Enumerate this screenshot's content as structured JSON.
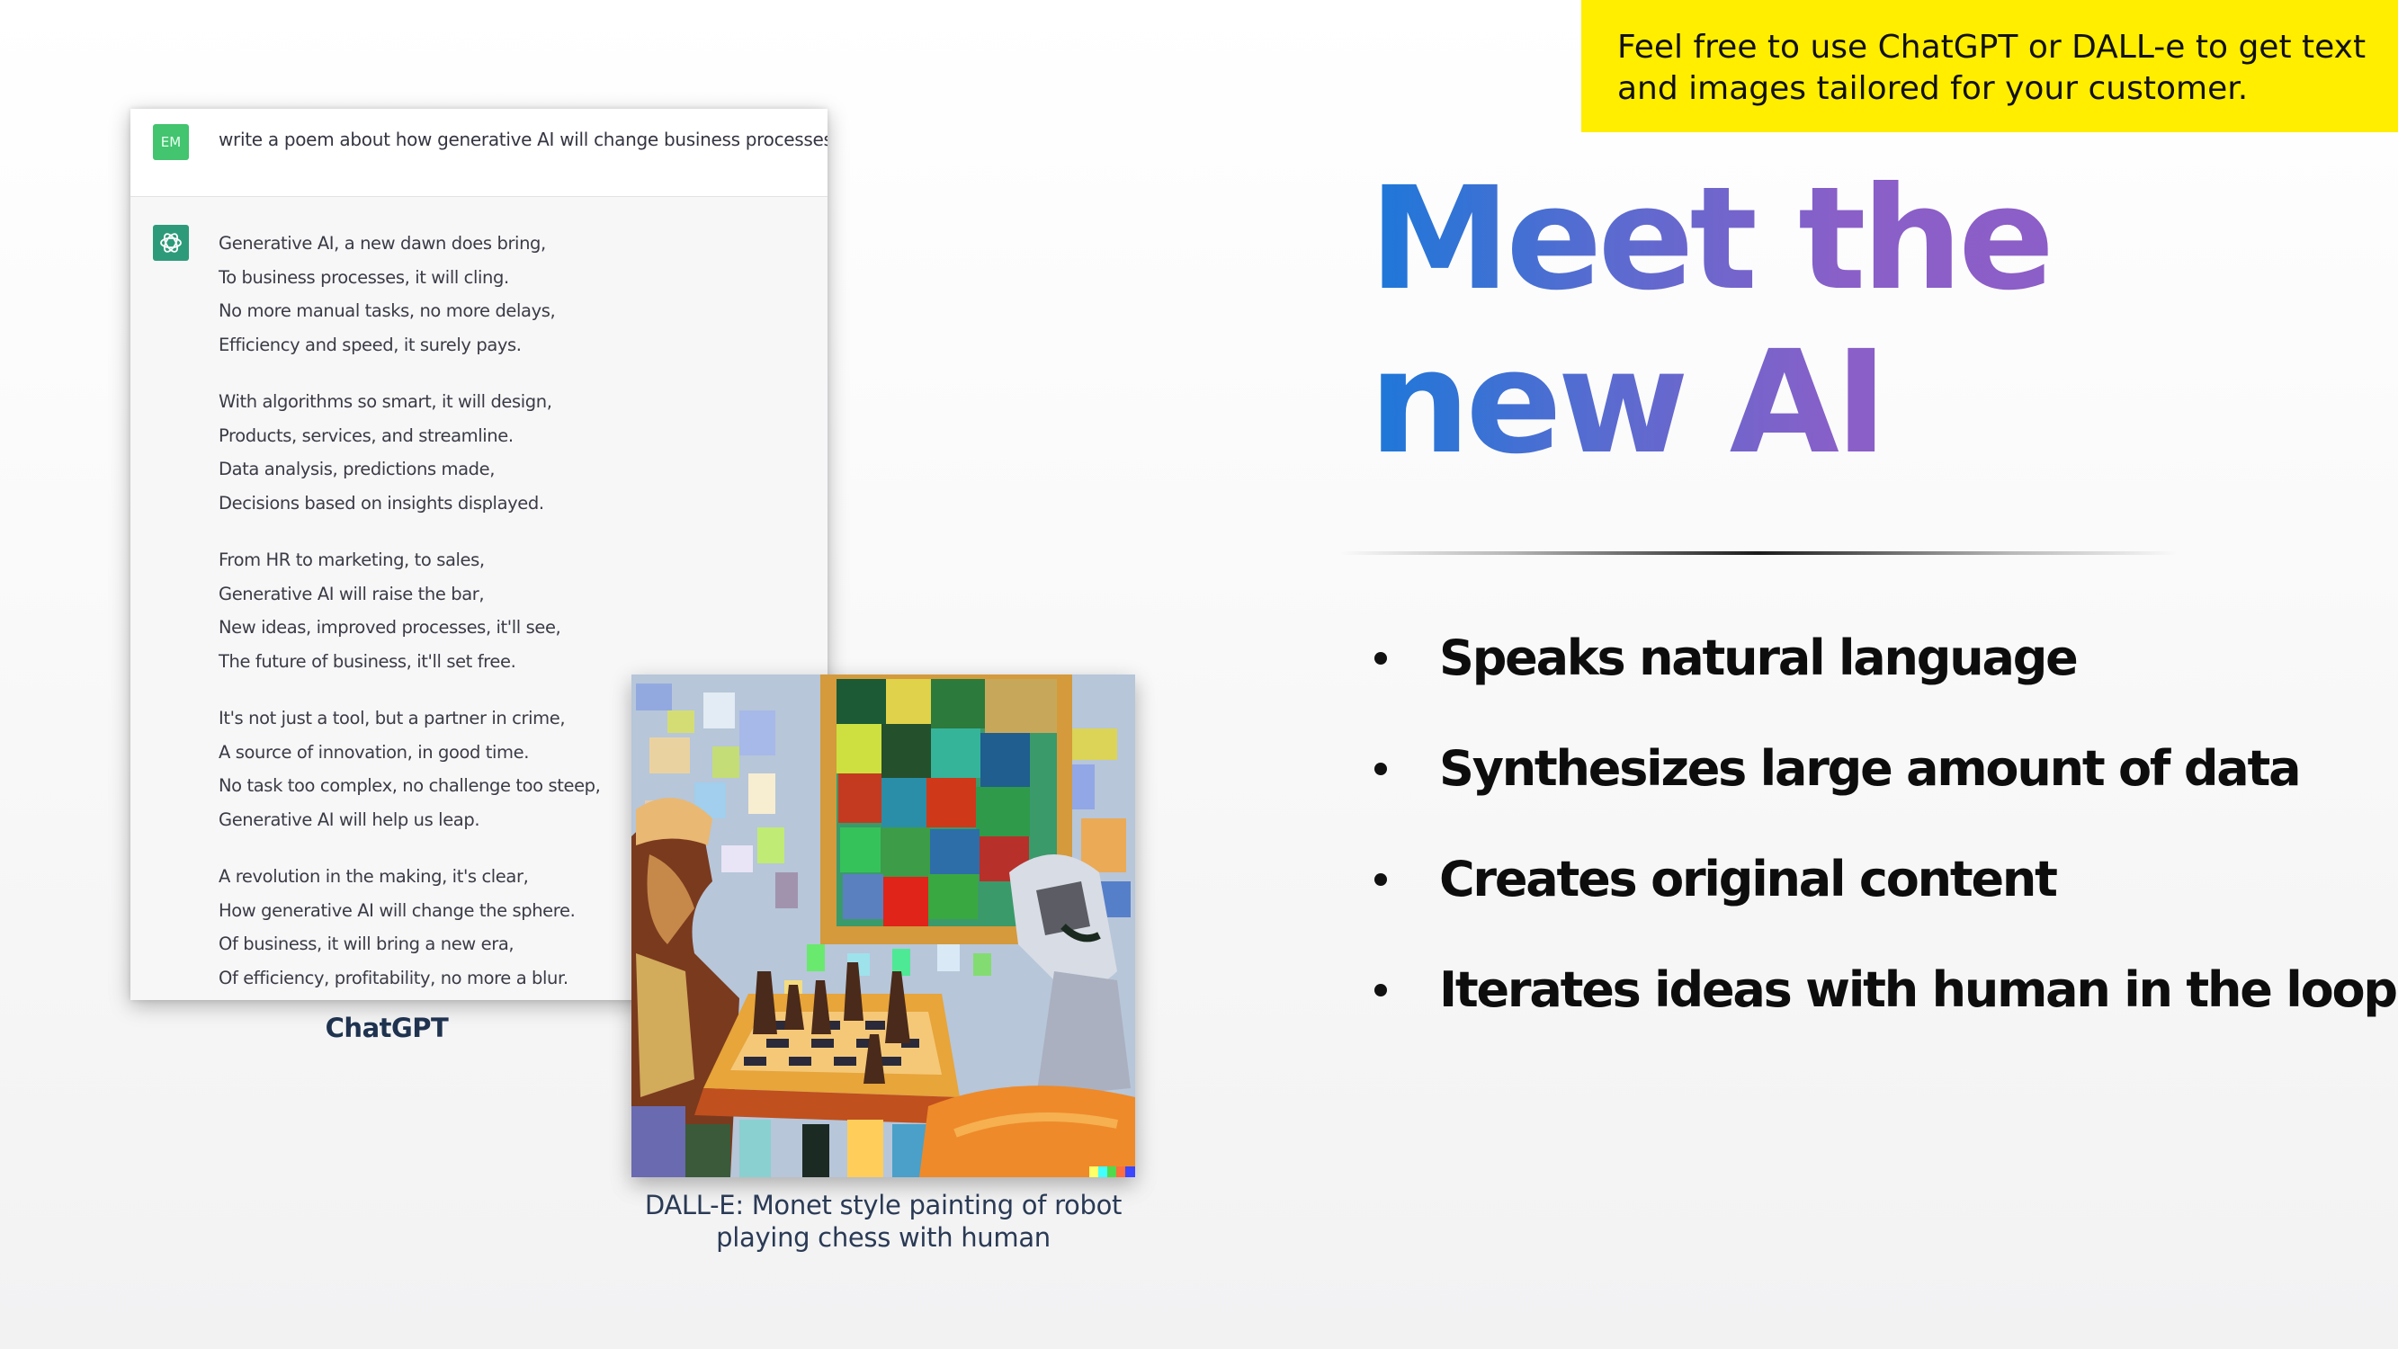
{
  "callout": {
    "lines": [
      "Feel free to use ChatGPT or DALL-e to get text",
      "and images tailored for your customer."
    ],
    "background_color": "#ffee00"
  },
  "chatgpt": {
    "user_avatar_initials": "EM",
    "user_avatar_color": "#43c46f",
    "assistant_icon": "openai-logo-icon",
    "assistant_icon_color": "#2d9b7a",
    "prompt": "write a poem about how generative AI will change business processes",
    "poem": [
      [
        "Generative AI, a new dawn does bring,",
        "To business processes, it will cling.",
        "No more manual tasks, no more delays,",
        "Efficiency and speed, it surely pays."
      ],
      [
        "With algorithms so smart, it will design,",
        "Products, services, and streamline.",
        "Data analysis, predictions made,",
        "Decisions based on insights displayed."
      ],
      [
        "From HR to marketing, to sales,",
        "Generative AI will raise the bar,",
        "New ideas, improved processes, it'll see,",
        "The future of business, it'll set free."
      ],
      [
        "It's not just a tool, but a partner in crime,",
        "A source of innovation, in good time.",
        "No task too complex, no challenge too steep,",
        "Generative AI will help us leap."
      ],
      [
        "A revolution in the making, it's clear,",
        "How generative AI will change the sphere.",
        "Of business, it will bring a new era,",
        "Of efficiency, profitability, no more a blur."
      ]
    ],
    "caption": "ChatGPT"
  },
  "dalle": {
    "image_description": "Monet style painting of robot playing chess with human",
    "caption_lines": [
      "DALL-E: Monet style painting of robot",
      "playing chess with human"
    ],
    "watermark_colors": [
      "#ffff66",
      "#42ffff",
      "#51da4c",
      "#ff6e3c",
      "#3c46ff"
    ]
  },
  "title": {
    "lines": [
      "Meet the",
      "new AI"
    ],
    "gradient": [
      "#1c78d9",
      "#8c5ec7"
    ]
  },
  "bullets": [
    "Speaks natural language",
    "Synthesizes large amount of data",
    "Creates original content",
    "Iterates ideas with human in the loop"
  ]
}
